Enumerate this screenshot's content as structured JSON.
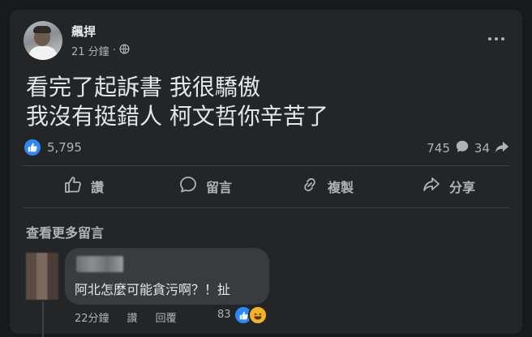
{
  "post": {
    "author": "飆捍",
    "time": "21 分鐘",
    "separator": "·",
    "text_lines": [
      "看完了起訴書 我很驕傲",
      "我沒有挺錯人 柯文哲你辛苦了"
    ]
  },
  "stats": {
    "likes": "5,795",
    "comments": "745",
    "shares": "34"
  },
  "actions": {
    "like": "讚",
    "comment": "留言",
    "copy": "複製",
    "share": "分享"
  },
  "comments_section": {
    "view_more": "查看更多留言",
    "comment": {
      "text": "阿北怎麼可能貪污啊？！扯",
      "time": "22分鐘",
      "like": "讚",
      "reply": "回覆",
      "reaction_count": "83"
    }
  },
  "colors": {
    "background": "#18191a",
    "card": "#242526",
    "bubble": "#3a3b3c",
    "accent": "#2d88ff",
    "text_primary": "#e4e6eb",
    "text_secondary": "#b0b3b8"
  }
}
